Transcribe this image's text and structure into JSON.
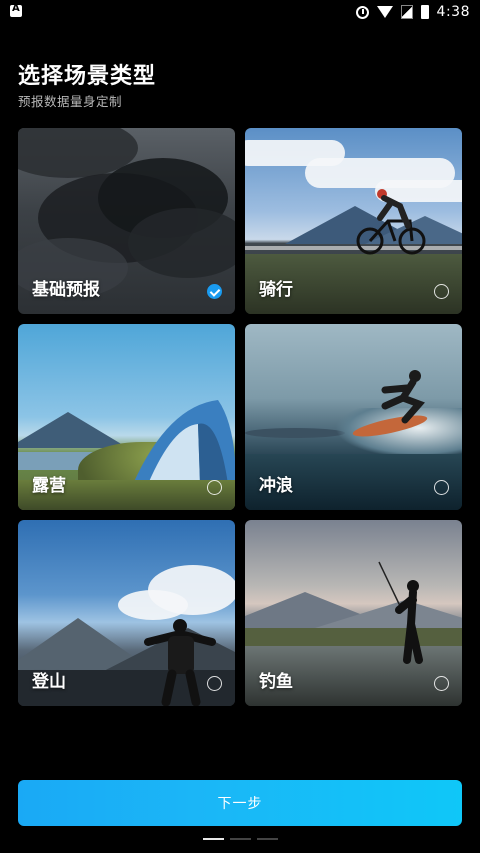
{
  "status_bar": {
    "time": "4:38",
    "icons": [
      "notification-a-icon",
      "alarm-icon",
      "wifi-icon",
      "signal-icon",
      "battery-icon"
    ]
  },
  "header": {
    "title": "选择场景类型",
    "subtitle": "预报数据量身定制"
  },
  "scenes": [
    {
      "label": "基础预报",
      "selected": true,
      "image": "storm-clouds"
    },
    {
      "label": "骑行",
      "selected": false,
      "image": "cyclist-mountains"
    },
    {
      "label": "露营",
      "selected": false,
      "image": "tent-lake"
    },
    {
      "label": "冲浪",
      "selected": false,
      "image": "surfer-wave"
    },
    {
      "label": "登山",
      "selected": false,
      "image": "climber-summit"
    },
    {
      "label": "钓鱼",
      "selected": false,
      "image": "angler-lake"
    }
  ],
  "footer": {
    "next_label": "下一步",
    "page_count": 3,
    "active_page": 1
  },
  "colors": {
    "accent": "#1a9bf0",
    "button_start": "#1aa9f5",
    "button_end": "#0fc7f8",
    "background": "#000000"
  }
}
